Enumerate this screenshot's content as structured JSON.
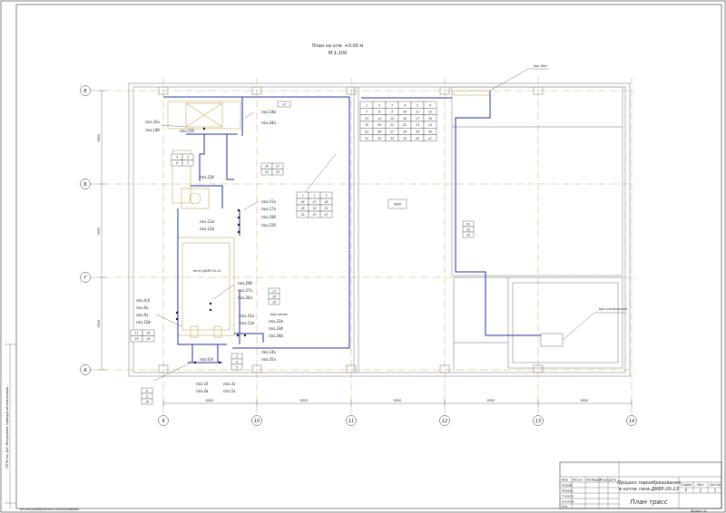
{
  "plan": {
    "title": "План на отм. +0.00 м",
    "scale": "М 1:100"
  },
  "axes": {
    "rows": [
      "В",
      "Б",
      "Г",
      "А"
    ],
    "cols": [
      "9",
      "10",
      "11",
      "12",
      "13",
      "14"
    ]
  },
  "dimensions": {
    "bottom": [
      "6000",
      "6000",
      "6000",
      "6000",
      "6000"
    ],
    "left": [
      "6000",
      "6000",
      "6000"
    ]
  },
  "labels": {
    "boiler": "Котел ДКВР-20-13",
    "cylinder": "Бак 10м³",
    "shield_auto": "Щит автом.",
    "shield_ctrl": "Щит контрольный",
    "center_tag": "4000",
    "block_tag": "Блок"
  },
  "positions": {
    "top_left": [
      "поз.16а",
      "поз.14б",
      "поз.14в",
      "поз.24а"
    ],
    "mid": [
      "поз.12б",
      "поз.15б"
    ],
    "side_col": [
      "поз.15а",
      "поз.17а",
      "поз.18б",
      "поз.21б"
    ],
    "left_mid": [
      "поз.11в",
      "поз.12в"
    ],
    "boiler_right": [
      "поз.29б",
      "поз.27а",
      "поз.26а"
    ],
    "left_low": [
      "поз.4,8",
      "поз.6а",
      "поз.9а",
      "поз.10в"
    ],
    "bottom_right": [
      "поз.31а",
      "поз.13в",
      "поз.32в",
      "поз.33б",
      "поз.34в"
    ],
    "bottom_right2": [
      "поз.14а",
      "поз.35а"
    ],
    "bottom": [
      "поз.4,8",
      "поз.1б",
      "поз.3а",
      "поз.2в",
      "поз.5а"
    ],
    "top_marker": "х7"
  },
  "tables": {
    "top_grid": [
      [
        "1",
        "2",
        "3",
        "4",
        "5",
        "6"
      ],
      [
        "7",
        "8",
        "9",
        "10",
        "11",
        "12"
      ],
      [
        "13",
        "14",
        "15",
        "16",
        "17",
        "18"
      ],
      [
        "19",
        "20",
        "21",
        "22",
        "23",
        "24"
      ],
      [
        "25",
        "26",
        "27",
        "28",
        "29",
        "30"
      ],
      [
        "31",
        "32",
        "33",
        "34",
        "х5",
        "х7"
      ]
    ],
    "mid_grid": [
      [
        "1",
        "2",
        "3"
      ],
      [
        "26",
        "27",
        "28"
      ],
      [
        "29",
        "30",
        "31"
      ],
      [
        "32",
        "33",
        "х7"
      ]
    ],
    "small_a": [
      [
        "20",
        "21"
      ],
      [
        "22",
        "23"
      ]
    ],
    "small_b": [
      [
        "11",
        "16"
      ],
      [
        "19",
        "18"
      ]
    ],
    "small_c": [
      [
        "17"
      ],
      [
        "18"
      ],
      [
        "19"
      ]
    ],
    "small_d": [
      [
        "21"
      ],
      [
        "22"
      ],
      [
        "23"
      ]
    ],
    "small_e": [
      [
        "4",
        "5"
      ],
      [
        "6",
        "7"
      ]
    ],
    "small_f": [
      [
        "8"
      ],
      [
        "9"
      ],
      [
        "10"
      ]
    ],
    "small_g": [
      [
        "3"
      ],
      [
        "4"
      ],
      [
        "5"
      ]
    ]
  },
  "title_block": {
    "doc_title_1": "Процесс парообразования",
    "doc_title_2": "в котле типа ДКВР-20-13",
    "sheet_name": "План трасс",
    "col_stage": "Стадия",
    "col_sheet": "Лист",
    "col_sheets": "Листов",
    "stage_val": "У",
    "sheet_val": "1",
    "sheets_val": "1",
    "format": "Формат А1",
    "rows": [
      "Изм.",
      "Кол.уч",
      "Лист",
      "№док",
      "Подп.",
      "Дата"
    ],
    "roles": [
      "Разраб.",
      "Провер.",
      "Т.контр.",
      "Н.контр.",
      "Утв."
    ]
  },
  "side_stamp": {
    "text": "ГНТКУ им. Д.И. Менделеева. Кафедра автоматизации ...",
    "bottom_note": "Не для коммерческого использования"
  }
}
